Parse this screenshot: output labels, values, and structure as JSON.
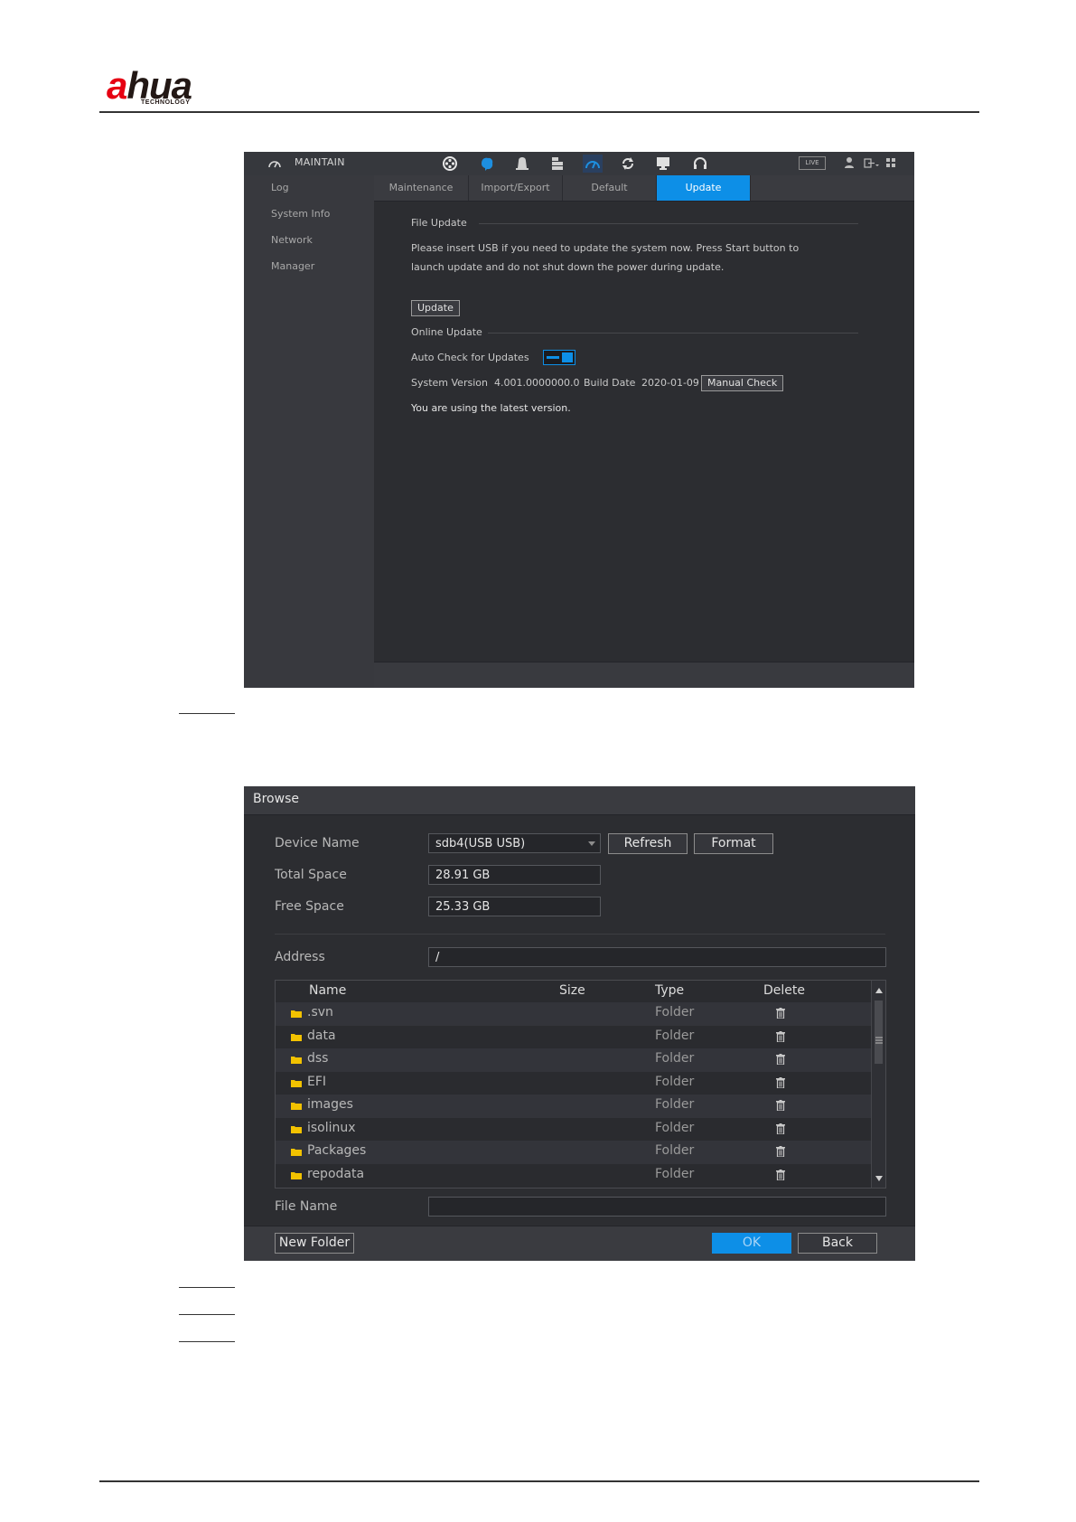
{
  "brand": {
    "logo_text_a": "a",
    "logo_text_rest": "hua",
    "logo_sub": "TECHNOLOGY"
  },
  "maintain": {
    "title": "MAINTAIN",
    "live_label": "LIVE",
    "sidebar": [
      "Log",
      "System Info",
      "Network",
      "Manager"
    ],
    "tabs": [
      "Maintenance",
      "Import/Export",
      "Default",
      "Update"
    ],
    "active_tab": "Update",
    "file_update": {
      "heading": "File Update",
      "line1": "Please insert USB if you need to update the system now. Press Start button to",
      "line2": "launch update and do not shut down the power during update.",
      "update_button": "Update"
    },
    "online_update": {
      "heading": "Online Update",
      "auto_check_label": "Auto Check for Updates",
      "auto_check_enabled": true,
      "system_version_label": "System Version",
      "system_version": "4.001.0000000.0",
      "build_date_label": "Build Date",
      "build_date": "2020-01-09",
      "manual_check_button": "Manual Check",
      "status": "You are using the latest version."
    },
    "accent_color": "#0d8fe7"
  },
  "browse": {
    "title": "Browse",
    "device_name_label": "Device Name",
    "device_name": "sdb4(USB USB)",
    "refresh_button": "Refresh",
    "format_button": "Format",
    "total_space_label": "Total Space",
    "total_space": "28.91 GB",
    "free_space_label": "Free Space",
    "free_space": "25.33 GB",
    "address_label": "Address",
    "address": "/",
    "columns": {
      "name": "Name",
      "size": "Size",
      "type": "Type",
      "delete": "Delete"
    },
    "rows": [
      {
        "name": ".svn",
        "size": "",
        "type": "Folder"
      },
      {
        "name": "data",
        "size": "",
        "type": "Folder"
      },
      {
        "name": "dss",
        "size": "",
        "type": "Folder"
      },
      {
        "name": "EFI",
        "size": "",
        "type": "Folder"
      },
      {
        "name": "images",
        "size": "",
        "type": "Folder"
      },
      {
        "name": "isolinux",
        "size": "",
        "type": "Folder"
      },
      {
        "name": "Packages",
        "size": "",
        "type": "Folder"
      },
      {
        "name": "repodata",
        "size": "",
        "type": "Folder"
      }
    ],
    "file_name_label": "File Name",
    "file_name": "",
    "new_folder_button": "New Folder",
    "ok_button": "OK",
    "back_button": "Back",
    "folder_color": "#f2c200"
  }
}
